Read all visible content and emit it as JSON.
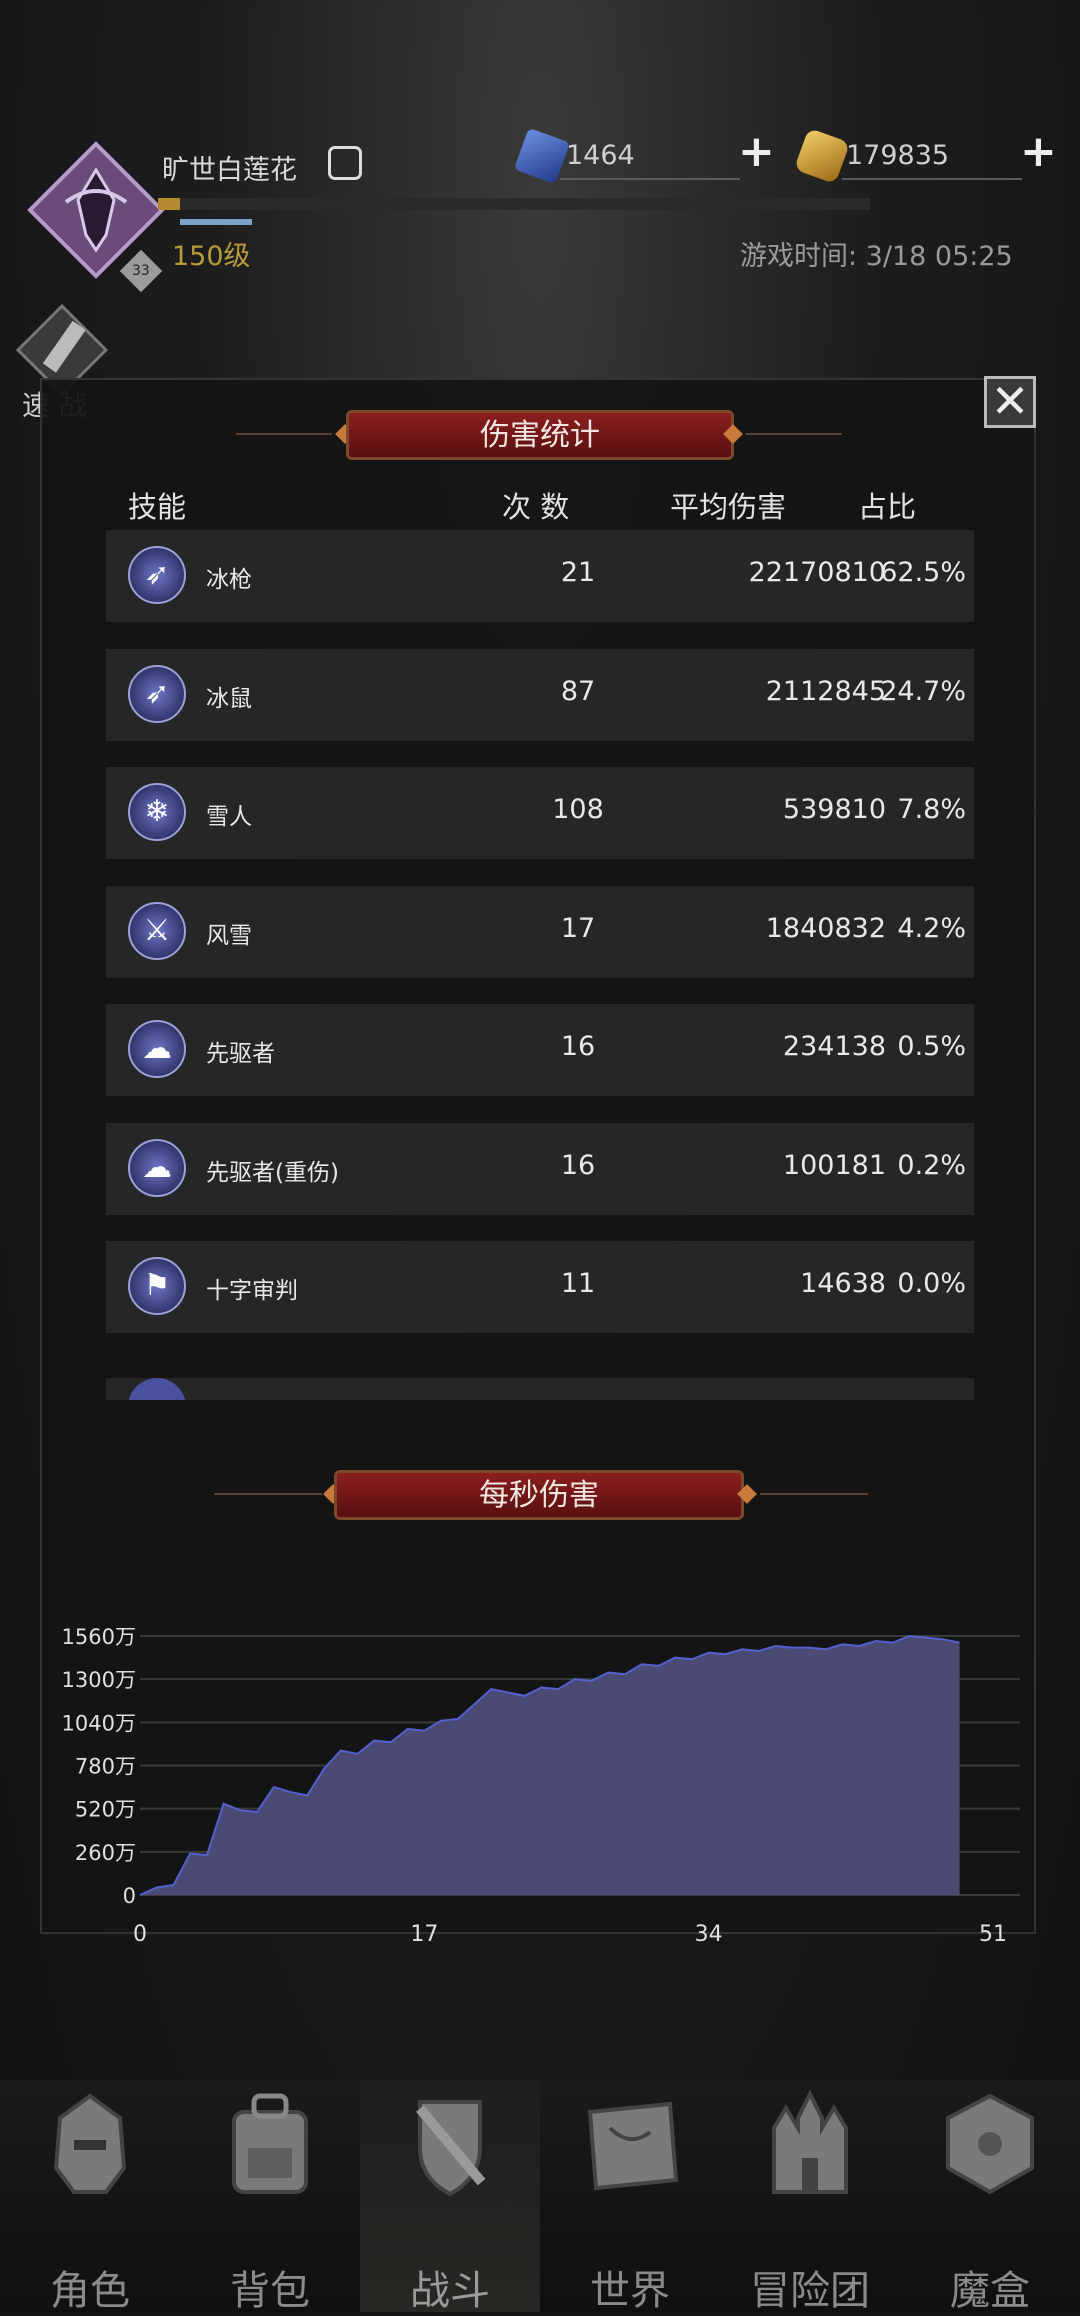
{
  "header": {
    "player_name": "旷世白莲花",
    "level": "150级",
    "avatar_badge": "33",
    "xp_fraction": 0.03,
    "resources": [
      {
        "name": "blue-gem",
        "value": "1464",
        "color": "#4a72c8"
      },
      {
        "name": "gold-coin",
        "value": "179835",
        "color": "#d6a63a"
      }
    ],
    "game_time": "游戏时间: 3/18 05:25",
    "quick_battle_label": "速 战"
  },
  "damage_panel": {
    "title": "伤害统计",
    "columns": [
      "技能",
      "次 数",
      "平均伤害",
      "占比"
    ],
    "rows": [
      {
        "icon": "spear-icon",
        "name": "冰枪",
        "count": "21",
        "avg": "22170810",
        "pct": "62.5%"
      },
      {
        "icon": "spear-icon",
        "name": "冰鼠",
        "count": "87",
        "avg": "2112845",
        "pct": "24.7%"
      },
      {
        "icon": "snowflake-icon",
        "name": "雪人",
        "count": "108",
        "avg": "539810",
        "pct": "7.8%"
      },
      {
        "icon": "sword-icon",
        "name": "风雪",
        "count": "17",
        "avg": "1840832",
        "pct": "4.2%"
      },
      {
        "icon": "cloud-icon",
        "name": "先驱者",
        "count": "16",
        "avg": "234138",
        "pct": "0.5%"
      },
      {
        "icon": "cloud-icon",
        "name": "先驱者(重伤)",
        "count": "16",
        "avg": "100181",
        "pct": "0.2%"
      },
      {
        "icon": "banner-icon",
        "name": "十字审判",
        "count": "11",
        "avg": "14638",
        "pct": "0.0%"
      }
    ],
    "close_icon": "close-icon"
  },
  "dps_panel": {
    "title": "每秒伤害"
  },
  "chart_data": {
    "type": "area",
    "title": "每秒伤害",
    "x": [
      0,
      1,
      2,
      3,
      4,
      5,
      6,
      7,
      8,
      9,
      10,
      11,
      12,
      13,
      14,
      15,
      16,
      17,
      18,
      19,
      20,
      21,
      22,
      23,
      24,
      25,
      26,
      27,
      28,
      29,
      30,
      31,
      32,
      33,
      34,
      35,
      36,
      37,
      38,
      39,
      40,
      41,
      42,
      43,
      44,
      45,
      46,
      47,
      48,
      49
    ],
    "values": [
      0,
      45,
      60,
      250,
      240,
      550,
      510,
      500,
      650,
      620,
      600,
      760,
      870,
      850,
      930,
      920,
      1000,
      990,
      1050,
      1060,
      1150,
      1240,
      1220,
      1200,
      1250,
      1240,
      1300,
      1290,
      1340,
      1330,
      1390,
      1380,
      1430,
      1420,
      1460,
      1450,
      1480,
      1470,
      1500,
      1490,
      1490,
      1480,
      1510,
      1500,
      1530,
      1520,
      1560,
      1550,
      1540,
      1520
    ],
    "xticks": [
      0,
      17,
      34,
      51
    ],
    "yticks": [
      0,
      260,
      520,
      780,
      1040,
      1300,
      1560
    ],
    "ytick_labels": [
      "0",
      "260万",
      "520万",
      "780万",
      "1040万",
      "1300万",
      "1560万"
    ],
    "xlim": [
      0,
      51
    ],
    "ylim": [
      0,
      1560
    ],
    "grid": true,
    "fill_color": "#4a4a75",
    "line_color": "#5560d0"
  },
  "nav": [
    {
      "icon": "helmet-icon",
      "label": "角色"
    },
    {
      "icon": "backpack-icon",
      "label": "背包"
    },
    {
      "icon": "shield-sword-icon",
      "label": "战斗"
    },
    {
      "icon": "map-icon",
      "label": "世界"
    },
    {
      "icon": "castle-icon",
      "label": "冒险团"
    },
    {
      "icon": "cube-icon",
      "label": "魔盒"
    }
  ],
  "nav_active": "战斗"
}
